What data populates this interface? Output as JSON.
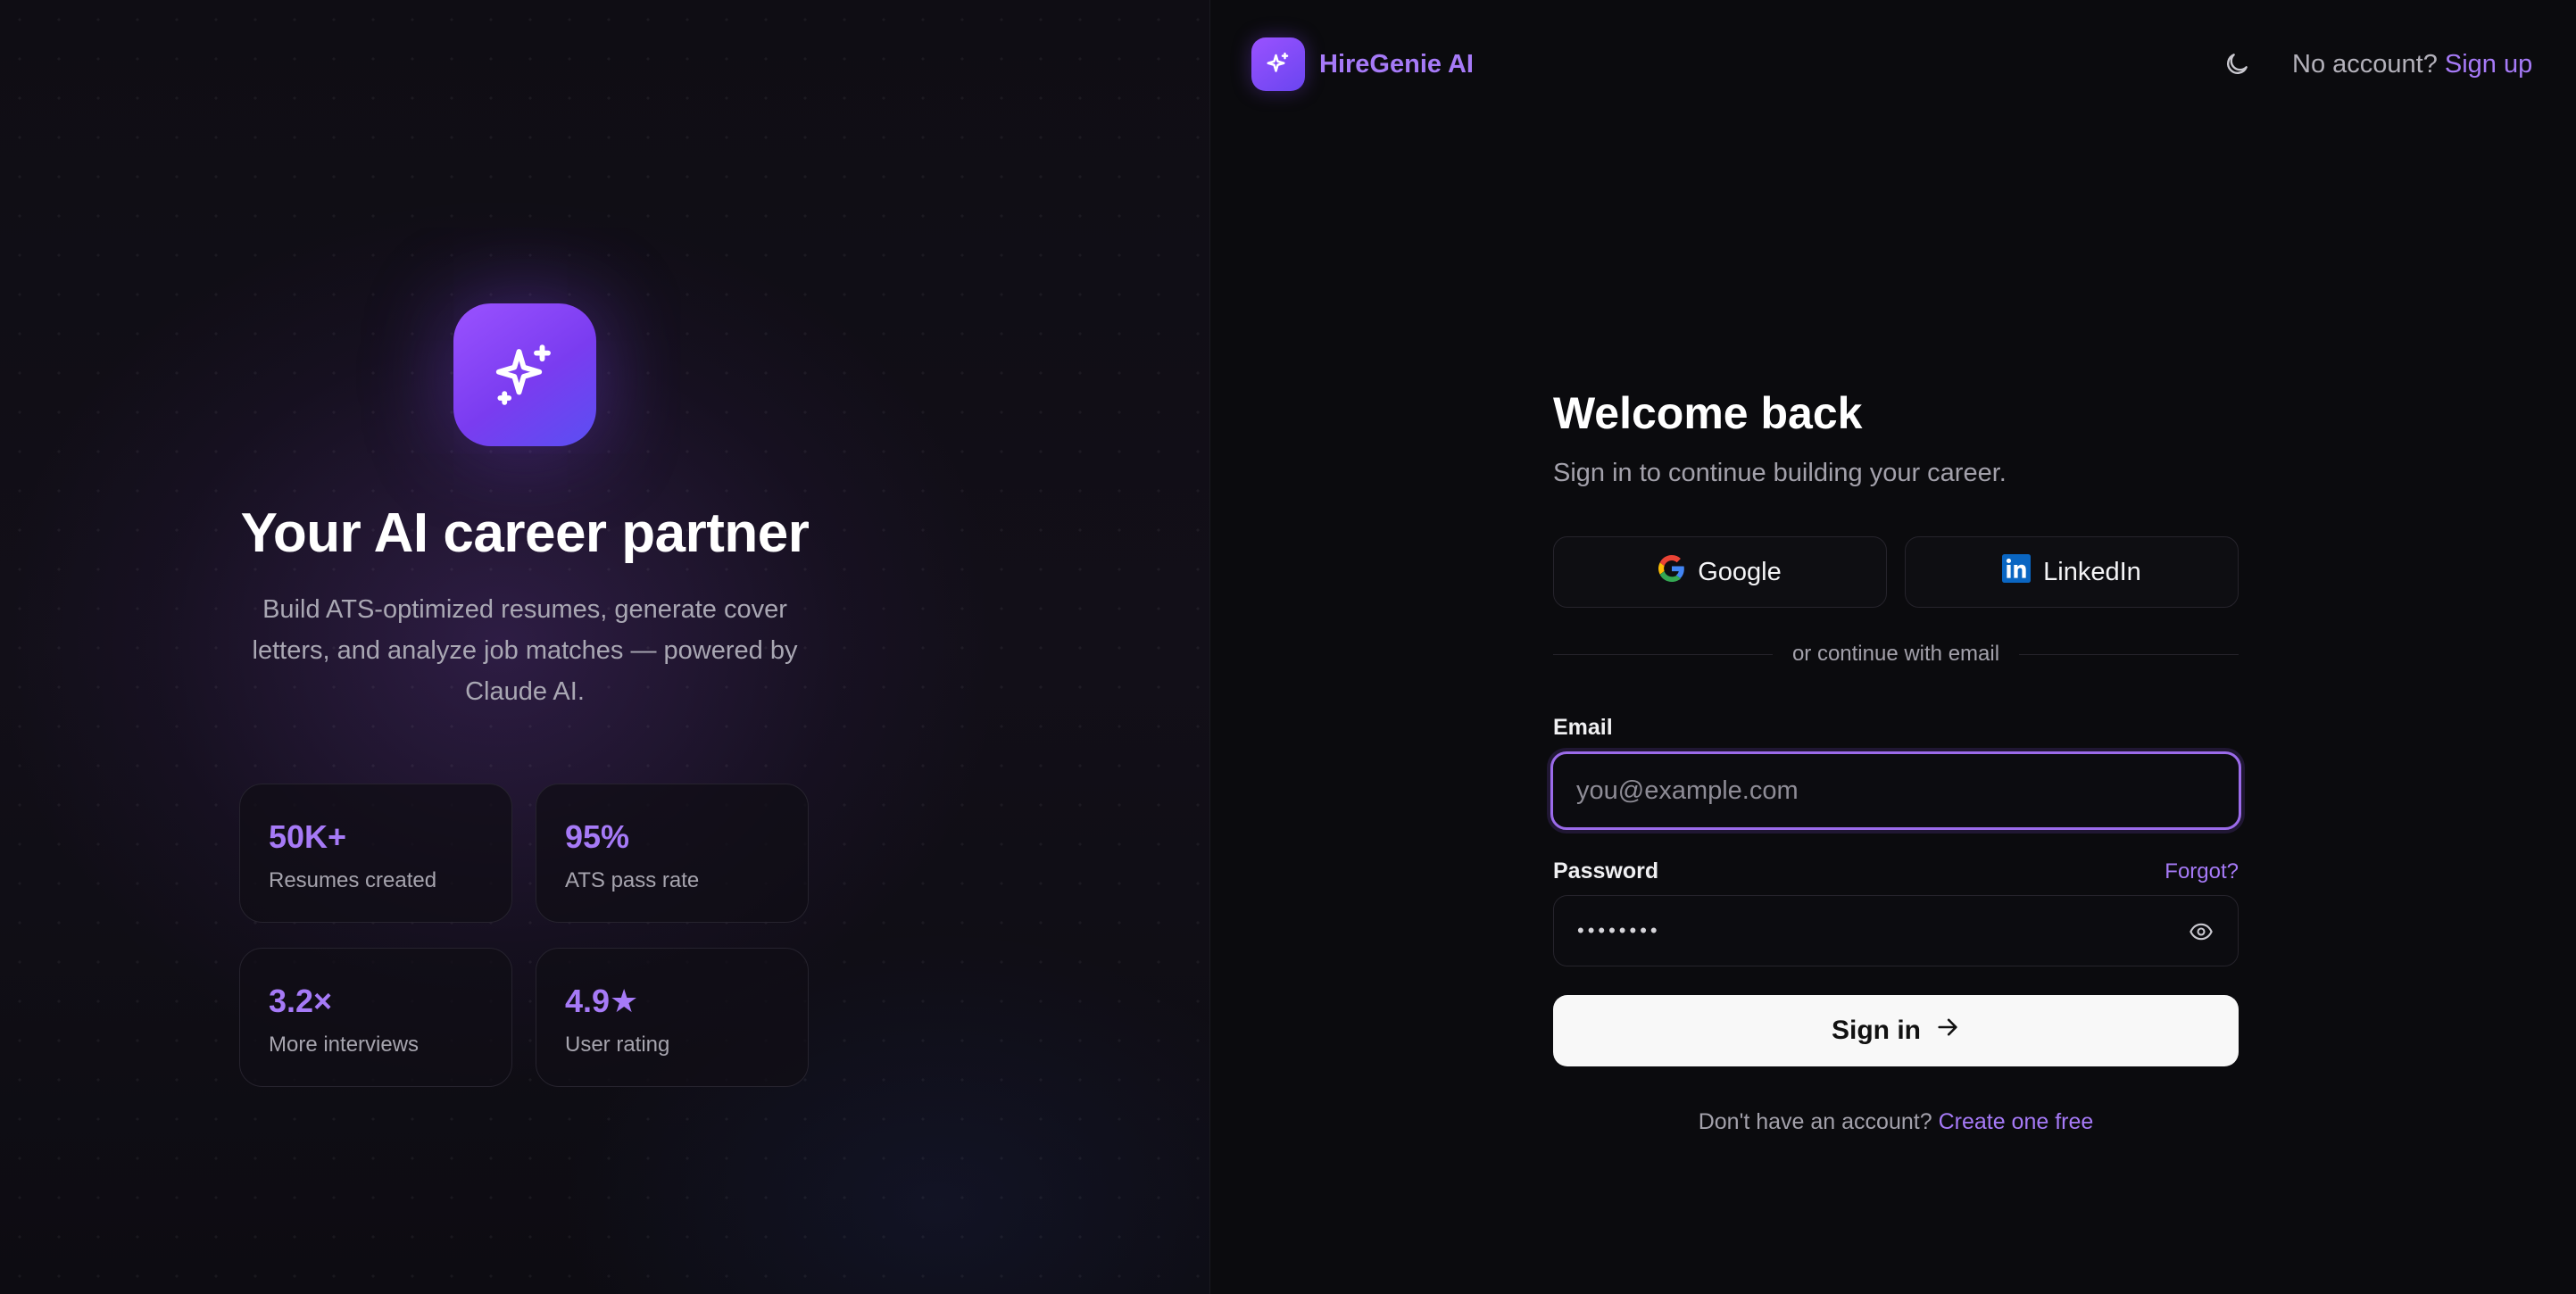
{
  "brand": {
    "name": "HireGenie AI"
  },
  "header": {
    "no_account_text": "No account?",
    "sign_up_label": "Sign up"
  },
  "hero": {
    "title": "Your AI career partner",
    "subtitle": "Build ATS-optimized resumes, generate cover letters, and analyze job matches — powered by Claude AI.",
    "stats": [
      {
        "value": "50K+",
        "label": "Resumes created"
      },
      {
        "value": "95%",
        "label": "ATS pass rate"
      },
      {
        "value": "3.2×",
        "label": "More interviews"
      },
      {
        "value": "4.9★",
        "label": "User rating"
      }
    ]
  },
  "form": {
    "title": "Welcome back",
    "subtitle": "Sign in to continue building your career.",
    "google_label": "Google",
    "linkedin_label": "LinkedIn",
    "divider_text": "or continue with email",
    "email_label": "Email",
    "email_placeholder": "you@example.com",
    "password_label": "Password",
    "forgot_label": "Forgot?",
    "password_mask": "••••••••",
    "signin_label": "Sign in",
    "bottom_text": "Don't have an account?",
    "create_label": "Create one free"
  },
  "colors": {
    "accent": "#a67af7",
    "background": "#0b0b0e",
    "primary_button": "#f8f8f8"
  },
  "icons": {
    "hero_logo": "sparkles-icon",
    "brand": "sparkles-icon",
    "theme_toggle": "moon-icon",
    "google": "google-icon",
    "linkedin": "linkedin-icon",
    "password_toggle": "eye-icon",
    "signin_arrow": "arrow-right-icon"
  }
}
